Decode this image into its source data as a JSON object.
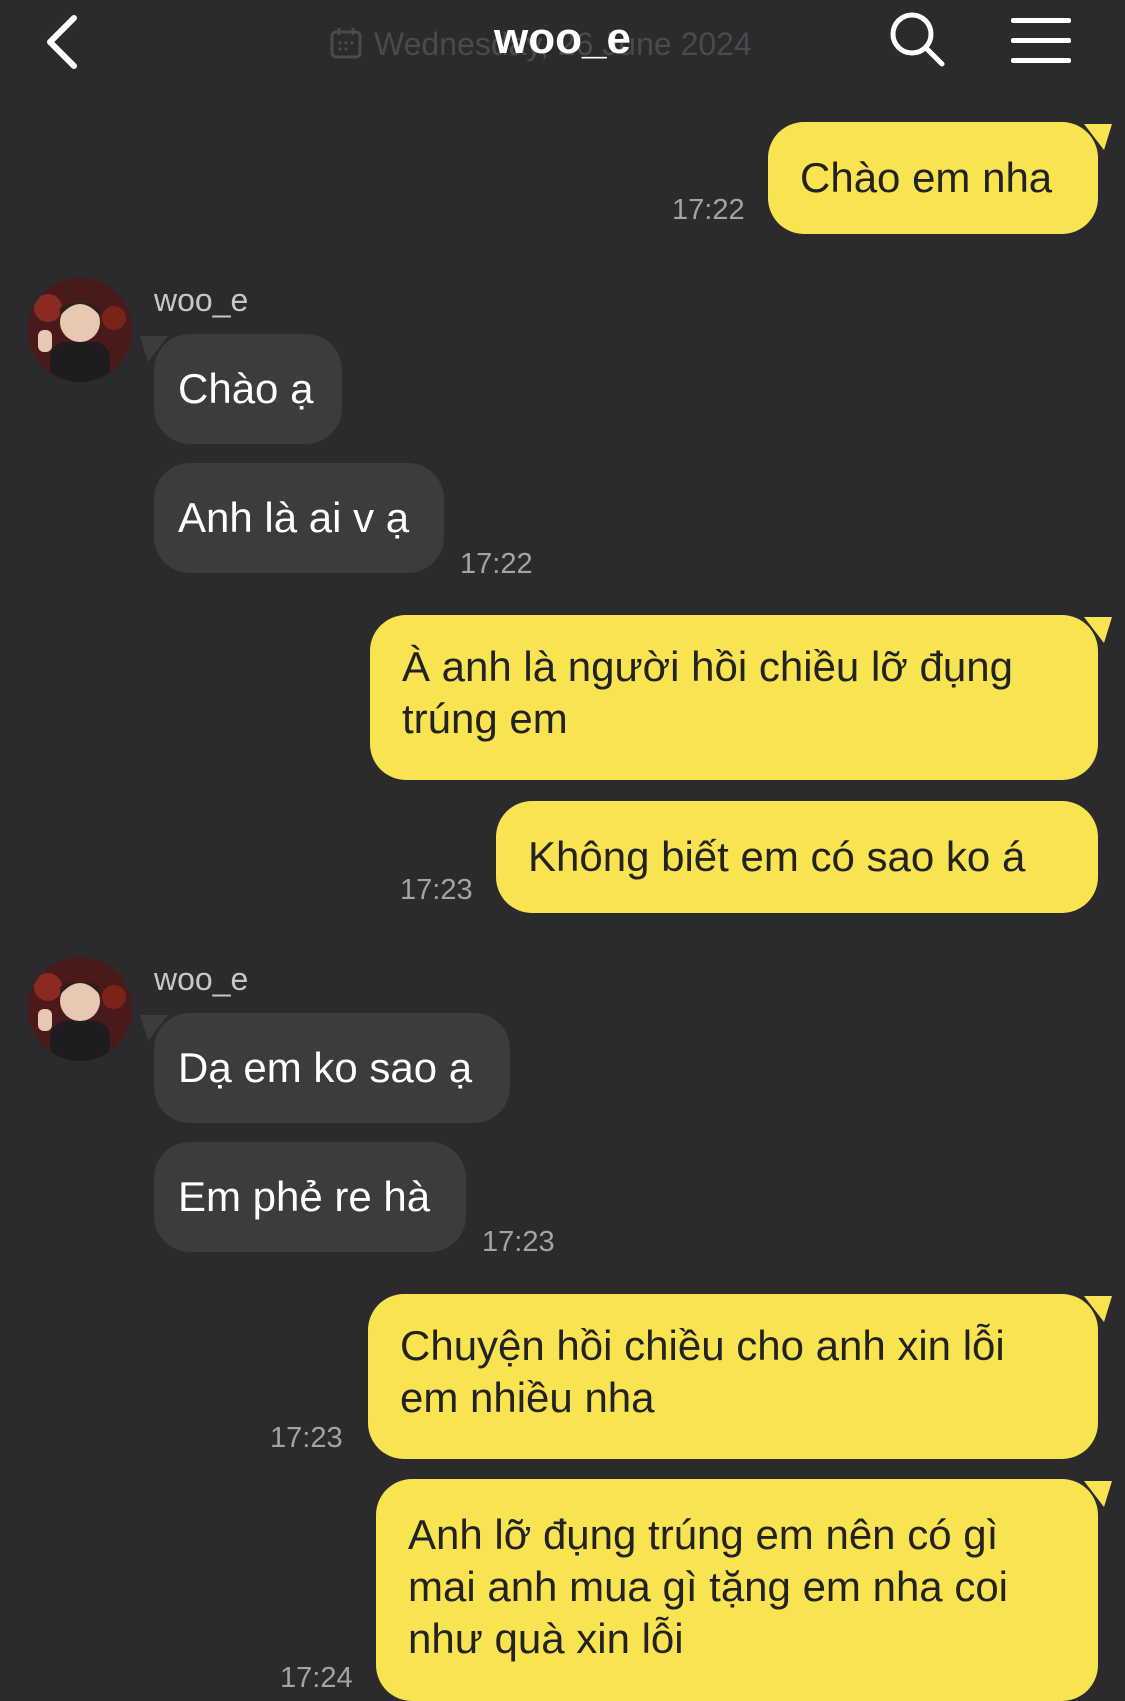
{
  "header": {
    "title": "woo_e",
    "date": "Wednesday, 26 June 2024"
  },
  "messages": [
    {
      "text": "Chào em nha",
      "time": "17:22"
    },
    {
      "name": "woo_e"
    },
    {
      "text": "Chào ạ"
    },
    {
      "text": "Anh là ai v ạ",
      "time": "17:22"
    },
    {
      "text": "À anh là người hồi chiều lỡ đụng trúng em"
    },
    {
      "text": "Không biết em có sao ko á",
      "time": "17:23"
    },
    {
      "name": "woo_e"
    },
    {
      "text": "Dạ em ko sao ạ"
    },
    {
      "text": "Em phẻ re hà",
      "time": "17:23"
    },
    {
      "text": "Chuyện hồi chiều cho anh xin lỗi em nhiều nha",
      "time": "17:23"
    },
    {
      "text": "Anh lỡ đụng trúng em nên có gì mai anh mua gì tặng em nha coi như quà xin lỗi",
      "time": "17:24"
    }
  ],
  "colors": {
    "background": "#2b2b2d",
    "my_bubble": "#fae350",
    "their_bubble": "#3c3c3e",
    "timestamp": "#a3a3a6"
  }
}
